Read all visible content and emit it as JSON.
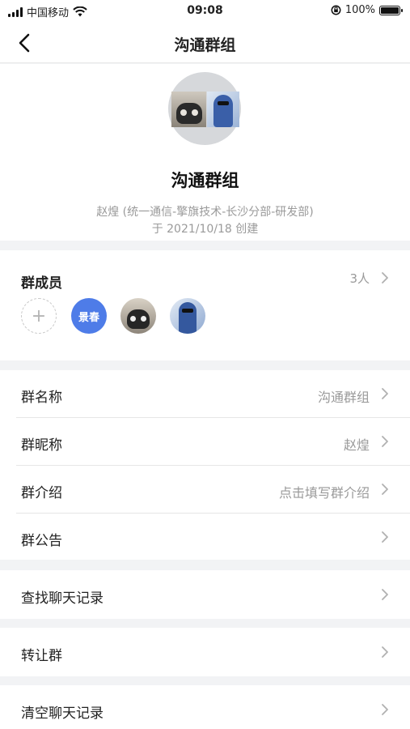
{
  "status_bar": {
    "carrier": "中国移动",
    "time": "09:08",
    "battery": "100%"
  },
  "nav": {
    "title": "沟通群组"
  },
  "group": {
    "name": "沟通群组",
    "creator": "赵煌 (统一通信-擎旗技术-长沙分部-研发部)",
    "created": "于 2021/10/18 创建"
  },
  "members": {
    "title": "群成员",
    "count": "3人",
    "add_symbol": "+",
    "items": [
      {
        "label": "景春",
        "color": "#4e7ce8"
      }
    ]
  },
  "settings": {
    "items": [
      {
        "label": "群名称",
        "value": "沟通群组"
      },
      {
        "label": "群昵称",
        "value": "赵煌"
      },
      {
        "label": "群介绍",
        "value": "点击填写群介绍"
      },
      {
        "label": "群公告",
        "value": ""
      }
    ]
  },
  "actions": {
    "search_history": "查找聊天记录",
    "transfer_group": "转让群",
    "clear_history": "清空聊天记录"
  },
  "colors": {
    "accent": "#4e7ce8",
    "background": "#f2f3f5",
    "secondary_text": "#9a9a9a"
  }
}
